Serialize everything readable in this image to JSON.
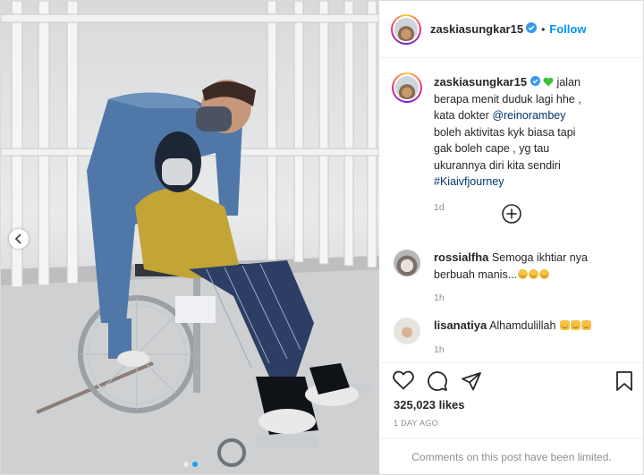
{
  "post": {
    "username": "zaskiasungkar15",
    "separator": "•",
    "follow_label": "Follow",
    "caption": {
      "part1": "jalan berapa menit duduk lagi hhe , kata dokter ",
      "mention": "@reinorambey",
      "part2": " boleh aktivitas kyk biasa tapi gak boleh cape , yg tau ukurannya diri kita sendiri ",
      "hashtag": "#Kiaivfjourney",
      "time": "1d"
    },
    "comments": [
      {
        "username": "rossialfha",
        "text": "Semoga ikhtiar nya berbuah manis...",
        "emoji_count": 3,
        "time": "1h"
      },
      {
        "username": "lisanatiya",
        "text": "Alhamdulillah",
        "emoji_count": 3,
        "time": "1h"
      }
    ],
    "likes": "325,023 likes",
    "date": "1 DAY AGO",
    "comments_limited": "Comments on this post have been limited.",
    "carousel": {
      "slides": 2,
      "active": 1
    },
    "icons": [
      "heart-icon",
      "comment-icon",
      "share-icon",
      "bookmark-icon",
      "add-circle-icon",
      "verified-badge-icon",
      "chevron-left-icon"
    ],
    "colors": {
      "link": "#0095f6",
      "mention": "#00376b",
      "muted": "#8e8e8e",
      "verified": "#3897f0",
      "heart_emoji": "#3cc13b"
    }
  }
}
